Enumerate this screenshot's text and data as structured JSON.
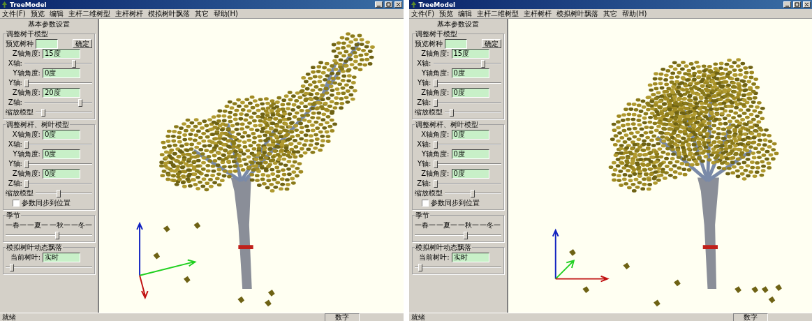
{
  "windows": [
    {
      "title": "TreeModel",
      "menu": [
        "文件(F)",
        "预览",
        "编辑",
        "主杆二维树型",
        "主杆树杆",
        "模拟树叶飘落",
        "其它",
        "帮助(H)"
      ],
      "panel": {
        "heading": "基本参数设置",
        "groups": [
          {
            "title": "调整树干模型",
            "items": [
              {
                "kind": "preview",
                "label": "预览树种",
                "button": "确定"
              },
              {
                "kind": "field",
                "label": "Z轴角度:",
                "value": "15度"
              },
              {
                "kind": "slider",
                "label": "X轴:",
                "level": 0.75
              },
              {
                "kind": "field",
                "label": "Y轴角度:",
                "value": "0度"
              },
              {
                "kind": "slider",
                "label": "Y轴:",
                "level": 0
              },
              {
                "kind": "field",
                "label": "Z轴角度:",
                "value": "20度"
              },
              {
                "kind": "slider",
                "label": "Z轴:",
                "level": 0.85
              },
              {
                "kind": "slider",
                "label": "缩放模型",
                "level": 0.1
              }
            ]
          },
          {
            "title": "调整树杆、树叶模型",
            "items": [
              {
                "kind": "field",
                "label": "X轴角度:",
                "value": "0度"
              },
              {
                "kind": "slider",
                "label": "X轴:",
                "level": 0
              },
              {
                "kind": "field",
                "label": "Y轴角度:",
                "value": "0度"
              },
              {
                "kind": "slider",
                "label": "Y轴:",
                "level": 0
              },
              {
                "kind": "field",
                "label": "Z轴角度:",
                "value": "0度"
              },
              {
                "kind": "slider",
                "label": "Z轴:",
                "level": 0
              },
              {
                "kind": "slider",
                "label": "缩放模型",
                "level": 0.4
              },
              {
                "kind": "checkbox",
                "label": "参数同步到位置",
                "checked": false
              }
            ]
          },
          {
            "title": "季节",
            "items": [
              {
                "kind": "ticks",
                "labels": [
                  "一春一",
                  "一夏一",
                  "一秋一",
                  "一冬一"
                ]
              },
              {
                "kind": "slider",
                "level": 0.6
              }
            ]
          },
          {
            "title": "模拟树叶动态飘落",
            "items": [
              {
                "kind": "field",
                "label": "当前树叶:",
                "value": "实时"
              },
              {
                "kind": "slider",
                "level": 0.05
              }
            ]
          }
        ]
      },
      "status": [
        "就绪",
        "数字"
      ]
    },
    {
      "title": "TreeModel",
      "menu": [
        "文件(F)",
        "预览",
        "编辑",
        "主杆二维树型",
        "主杆树杆",
        "模拟树叶飘落",
        "其它",
        "帮助(H)"
      ],
      "panel": {
        "heading": "基本参数设置",
        "groups": [
          {
            "title": "调整树干模型",
            "items": [
              {
                "kind": "preview",
                "label": "预览树种",
                "button": "确定"
              },
              {
                "kind": "field",
                "label": "Z轴角度:",
                "value": "15度"
              },
              {
                "kind": "slider",
                "label": "X轴:",
                "level": 0.75
              },
              {
                "kind": "field",
                "label": "Y轴角度:",
                "value": "0度"
              },
              {
                "kind": "slider",
                "label": "Y轴:",
                "level": 0
              },
              {
                "kind": "field",
                "label": "Z轴角度:",
                "value": "0度"
              },
              {
                "kind": "slider",
                "label": "Z轴:",
                "level": 0
              },
              {
                "kind": "slider",
                "label": "缩放模型",
                "level": 0.1
              }
            ]
          },
          {
            "title": "调整树杆、树叶模型",
            "items": [
              {
                "kind": "field",
                "label": "X轴角度:",
                "value": "0度"
              },
              {
                "kind": "slider",
                "label": "X轴:",
                "level": 0
              },
              {
                "kind": "field",
                "label": "Y轴角度:",
                "value": "0度"
              },
              {
                "kind": "slider",
                "label": "Y轴:",
                "level": 0
              },
              {
                "kind": "field",
                "label": "Z轴角度:",
                "value": "0度"
              },
              {
                "kind": "slider",
                "label": "Z轴:",
                "level": 0
              },
              {
                "kind": "slider",
                "label": "缩放模型",
                "level": 0.5
              },
              {
                "kind": "checkbox",
                "label": "参数同步到位置",
                "checked": false
              }
            ]
          },
          {
            "title": "季节",
            "items": [
              {
                "kind": "ticks",
                "labels": [
                  "一春一",
                  "一夏一",
                  "一秋一",
                  "一冬一"
                ]
              },
              {
                "kind": "slider",
                "level": 0.6
              }
            ]
          },
          {
            "title": "模拟树叶动态飘落",
            "items": [
              {
                "kind": "field",
                "label": "当前树叶:",
                "value": "实时"
              },
              {
                "kind": "slider",
                "level": 0.05
              }
            ]
          }
        ]
      },
      "status": [
        "就绪",
        "数字"
      ]
    }
  ]
}
